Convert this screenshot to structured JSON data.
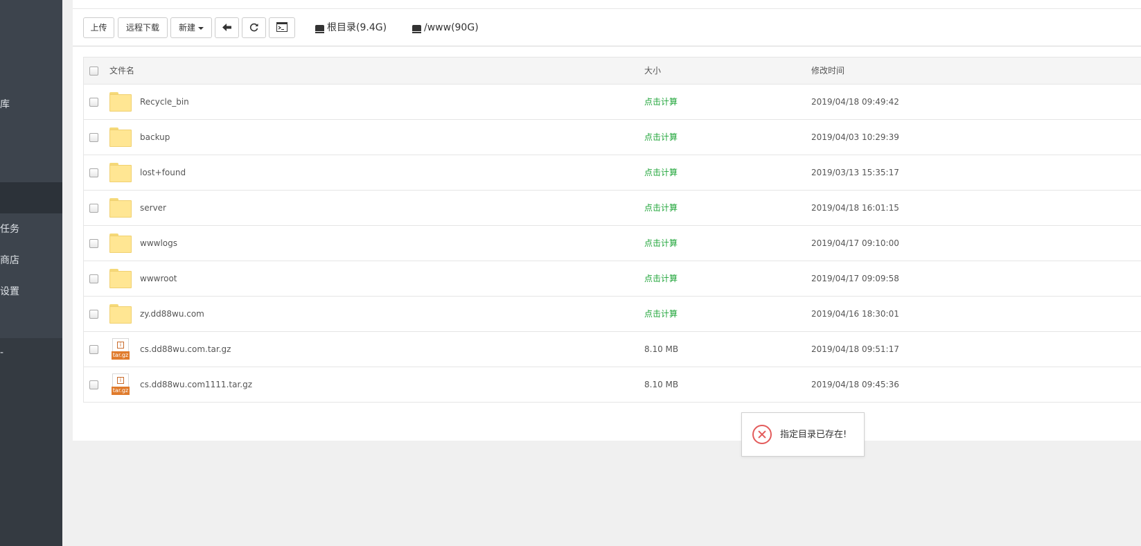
{
  "sidebar": {
    "items": [
      {
        "label": "库"
      },
      {
        "label": "任务"
      },
      {
        "label": "商店"
      },
      {
        "label": "设置"
      },
      {
        "label": "-"
      }
    ]
  },
  "toolbar": {
    "upload_label": "上传",
    "remote_download_label": "远程下载",
    "new_label": "新建",
    "back_icon": "back-arrow-icon",
    "refresh_icon": "refresh-icon",
    "terminal_icon": "terminal-icon",
    "disks": [
      {
        "label": "根目录(9.4G)",
        "icon": "hdd-icon"
      },
      {
        "label": "/www(90G)",
        "icon": "hdd-icon"
      }
    ]
  },
  "table": {
    "headers": {
      "name": "文件名",
      "size": "大小",
      "mtime": "修改时间"
    },
    "rows": [
      {
        "name": "Recycle_bin",
        "type": "folder",
        "size": "点击计算",
        "mtime": "2019/04/18 09:49:42"
      },
      {
        "name": "backup",
        "type": "folder",
        "size": "点击计算",
        "mtime": "2019/04/03 10:29:39"
      },
      {
        "name": "lost+found",
        "type": "folder",
        "size": "点击计算",
        "mtime": "2019/03/13 15:35:17"
      },
      {
        "name": "server",
        "type": "folder",
        "size": "点击计算",
        "mtime": "2019/04/18 16:01:15"
      },
      {
        "name": "wwwlogs",
        "type": "folder",
        "size": "点击计算",
        "mtime": "2019/04/17 09:10:00"
      },
      {
        "name": "wwwroot",
        "type": "folder",
        "size": "点击计算",
        "mtime": "2019/04/17 09:09:58"
      },
      {
        "name": "zy.dd88wu.com",
        "type": "folder",
        "size": "点击计算",
        "mtime": "2019/04/16 18:30:01"
      },
      {
        "name": "cs.dd88wu.com.tar.gz",
        "type": "archive",
        "badge": "tar.gz",
        "size": "8.10 MB",
        "mtime": "2019/04/18 09:51:17"
      },
      {
        "name": "cs.dd88wu.com1111.tar.gz",
        "type": "archive",
        "badge": "tar.gz",
        "size": "8.10 MB",
        "mtime": "2019/04/18 09:45:36"
      }
    ]
  },
  "toast": {
    "message": "指定目录已存在!",
    "icon": "error-icon"
  },
  "colors": {
    "calc_link": "#20a53a",
    "sidebar_bg": "#3d444d",
    "error": "#e35b5b",
    "folder": "#ffe693"
  }
}
